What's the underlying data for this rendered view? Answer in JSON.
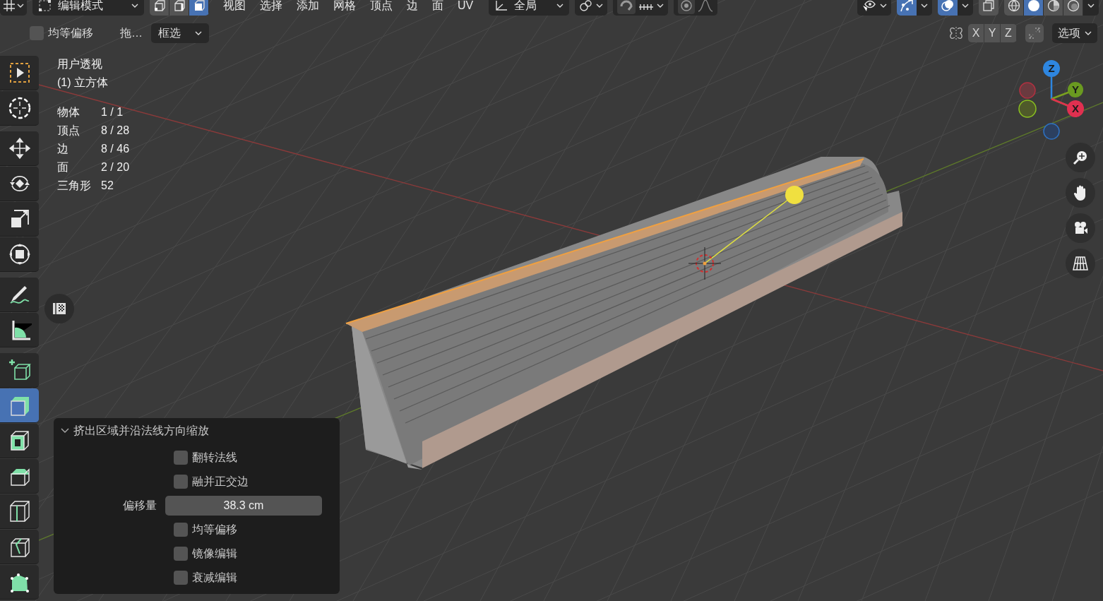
{
  "header": {
    "mode": "编辑模式",
    "select_modes": [
      {
        "kind": "vertex",
        "selected": false
      },
      {
        "kind": "edge",
        "selected": false
      },
      {
        "kind": "face",
        "selected": true
      }
    ],
    "menus": [
      "视图",
      "选择",
      "添加",
      "网格",
      "顶点",
      "边",
      "面",
      "UV"
    ],
    "orientation": "全局",
    "proportional_on": false,
    "snap_on": false,
    "gizmos_on": true,
    "overlays_on": true,
    "xray_on": false,
    "shading": [
      {
        "kind": "wireframe",
        "selected": false
      },
      {
        "kind": "solid",
        "selected": true
      },
      {
        "kind": "material",
        "selected": false
      },
      {
        "kind": "rendered",
        "selected": false
      }
    ]
  },
  "tool_header": {
    "even_offset": {
      "label": "均等偏移",
      "checked": false
    },
    "drag_label": "拖…",
    "drag_mode": "框选",
    "mirror_axes": [
      "X",
      "Y",
      "Z"
    ],
    "options": "选项"
  },
  "viewport": {
    "view_name": "用户透视",
    "object_name": "(1) 立方体",
    "stats": [
      {
        "label": "物体",
        "value": "1 / 1"
      },
      {
        "label": "顶点",
        "value": "8 / 28"
      },
      {
        "label": "边",
        "value": "8 / 46"
      },
      {
        "label": "面",
        "value": "2 / 20"
      },
      {
        "label": "三角形",
        "value": "52"
      }
    ],
    "gizmo_axes": [
      "Z",
      "Y",
      "X"
    ]
  },
  "toolbar": [
    {
      "kind": "select-box",
      "selected": false
    },
    {
      "kind": "cursor",
      "selected": false
    },
    {
      "kind": "move",
      "selected": false
    },
    {
      "kind": "rotate",
      "selected": false
    },
    {
      "kind": "scale",
      "selected": false
    },
    {
      "kind": "transform",
      "selected": false
    },
    {
      "kind": "annotate",
      "selected": false
    },
    {
      "kind": "measure",
      "selected": false
    },
    {
      "kind": "add-cube",
      "selected": false
    },
    {
      "kind": "extrude",
      "selected": true
    },
    {
      "kind": "inset",
      "selected": false
    },
    {
      "kind": "bevel",
      "selected": false
    },
    {
      "kind": "loop-cut",
      "selected": false
    },
    {
      "kind": "knife",
      "selected": false
    },
    {
      "kind": "poly-build",
      "selected": false
    }
  ],
  "operator_panel": {
    "title": "挤出区域并沿法线方向缩放",
    "expanded": true,
    "options": [
      {
        "kind": "checkbox",
        "label": "翻转法线",
        "checked": false
      },
      {
        "kind": "checkbox",
        "label": "融并正交边",
        "checked": false
      },
      {
        "kind": "number",
        "label": "偏移量",
        "value": "38.3 cm"
      },
      {
        "kind": "checkbox",
        "label": "均等偏移",
        "checked": false
      },
      {
        "kind": "checkbox",
        "label": "镜像编辑",
        "checked": false
      },
      {
        "kind": "checkbox",
        "label": "衰减编辑",
        "checked": false
      }
    ]
  }
}
